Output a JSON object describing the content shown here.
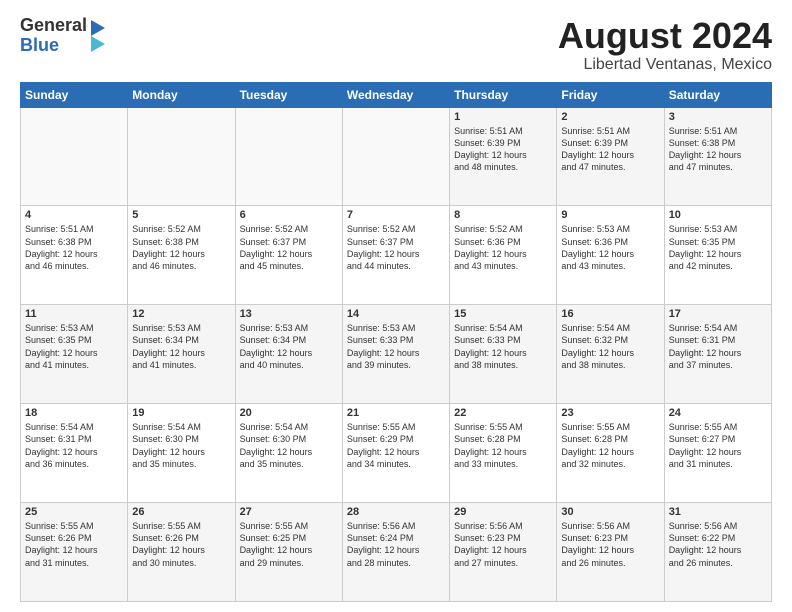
{
  "header": {
    "logo_general": "General",
    "logo_blue": "Blue",
    "title": "August 2024",
    "subtitle": "Libertad Ventanas, Mexico"
  },
  "calendar": {
    "days_of_week": [
      "Sunday",
      "Monday",
      "Tuesday",
      "Wednesday",
      "Thursday",
      "Friday",
      "Saturday"
    ],
    "weeks": [
      [
        {
          "day": "",
          "text": ""
        },
        {
          "day": "",
          "text": ""
        },
        {
          "day": "",
          "text": ""
        },
        {
          "day": "",
          "text": ""
        },
        {
          "day": "1",
          "text": "Sunrise: 5:51 AM\nSunset: 6:39 PM\nDaylight: 12 hours\nand 48 minutes."
        },
        {
          "day": "2",
          "text": "Sunrise: 5:51 AM\nSunset: 6:39 PM\nDaylight: 12 hours\nand 47 minutes."
        },
        {
          "day": "3",
          "text": "Sunrise: 5:51 AM\nSunset: 6:38 PM\nDaylight: 12 hours\nand 47 minutes."
        }
      ],
      [
        {
          "day": "4",
          "text": "Sunrise: 5:51 AM\nSunset: 6:38 PM\nDaylight: 12 hours\nand 46 minutes."
        },
        {
          "day": "5",
          "text": "Sunrise: 5:52 AM\nSunset: 6:38 PM\nDaylight: 12 hours\nand 46 minutes."
        },
        {
          "day": "6",
          "text": "Sunrise: 5:52 AM\nSunset: 6:37 PM\nDaylight: 12 hours\nand 45 minutes."
        },
        {
          "day": "7",
          "text": "Sunrise: 5:52 AM\nSunset: 6:37 PM\nDaylight: 12 hours\nand 44 minutes."
        },
        {
          "day": "8",
          "text": "Sunrise: 5:52 AM\nSunset: 6:36 PM\nDaylight: 12 hours\nand 43 minutes."
        },
        {
          "day": "9",
          "text": "Sunrise: 5:53 AM\nSunset: 6:36 PM\nDaylight: 12 hours\nand 43 minutes."
        },
        {
          "day": "10",
          "text": "Sunrise: 5:53 AM\nSunset: 6:35 PM\nDaylight: 12 hours\nand 42 minutes."
        }
      ],
      [
        {
          "day": "11",
          "text": "Sunrise: 5:53 AM\nSunset: 6:35 PM\nDaylight: 12 hours\nand 41 minutes."
        },
        {
          "day": "12",
          "text": "Sunrise: 5:53 AM\nSunset: 6:34 PM\nDaylight: 12 hours\nand 41 minutes."
        },
        {
          "day": "13",
          "text": "Sunrise: 5:53 AM\nSunset: 6:34 PM\nDaylight: 12 hours\nand 40 minutes."
        },
        {
          "day": "14",
          "text": "Sunrise: 5:53 AM\nSunset: 6:33 PM\nDaylight: 12 hours\nand 39 minutes."
        },
        {
          "day": "15",
          "text": "Sunrise: 5:54 AM\nSunset: 6:33 PM\nDaylight: 12 hours\nand 38 minutes."
        },
        {
          "day": "16",
          "text": "Sunrise: 5:54 AM\nSunset: 6:32 PM\nDaylight: 12 hours\nand 38 minutes."
        },
        {
          "day": "17",
          "text": "Sunrise: 5:54 AM\nSunset: 6:31 PM\nDaylight: 12 hours\nand 37 minutes."
        }
      ],
      [
        {
          "day": "18",
          "text": "Sunrise: 5:54 AM\nSunset: 6:31 PM\nDaylight: 12 hours\nand 36 minutes."
        },
        {
          "day": "19",
          "text": "Sunrise: 5:54 AM\nSunset: 6:30 PM\nDaylight: 12 hours\nand 35 minutes."
        },
        {
          "day": "20",
          "text": "Sunrise: 5:54 AM\nSunset: 6:30 PM\nDaylight: 12 hours\nand 35 minutes."
        },
        {
          "day": "21",
          "text": "Sunrise: 5:55 AM\nSunset: 6:29 PM\nDaylight: 12 hours\nand 34 minutes."
        },
        {
          "day": "22",
          "text": "Sunrise: 5:55 AM\nSunset: 6:28 PM\nDaylight: 12 hours\nand 33 minutes."
        },
        {
          "day": "23",
          "text": "Sunrise: 5:55 AM\nSunset: 6:28 PM\nDaylight: 12 hours\nand 32 minutes."
        },
        {
          "day": "24",
          "text": "Sunrise: 5:55 AM\nSunset: 6:27 PM\nDaylight: 12 hours\nand 31 minutes."
        }
      ],
      [
        {
          "day": "25",
          "text": "Sunrise: 5:55 AM\nSunset: 6:26 PM\nDaylight: 12 hours\nand 31 minutes."
        },
        {
          "day": "26",
          "text": "Sunrise: 5:55 AM\nSunset: 6:26 PM\nDaylight: 12 hours\nand 30 minutes."
        },
        {
          "day": "27",
          "text": "Sunrise: 5:55 AM\nSunset: 6:25 PM\nDaylight: 12 hours\nand 29 minutes."
        },
        {
          "day": "28",
          "text": "Sunrise: 5:56 AM\nSunset: 6:24 PM\nDaylight: 12 hours\nand 28 minutes."
        },
        {
          "day": "29",
          "text": "Sunrise: 5:56 AM\nSunset: 6:23 PM\nDaylight: 12 hours\nand 27 minutes."
        },
        {
          "day": "30",
          "text": "Sunrise: 5:56 AM\nSunset: 6:23 PM\nDaylight: 12 hours\nand 26 minutes."
        },
        {
          "day": "31",
          "text": "Sunrise: 5:56 AM\nSunset: 6:22 PM\nDaylight: 12 hours\nand 26 minutes."
        }
      ]
    ]
  }
}
